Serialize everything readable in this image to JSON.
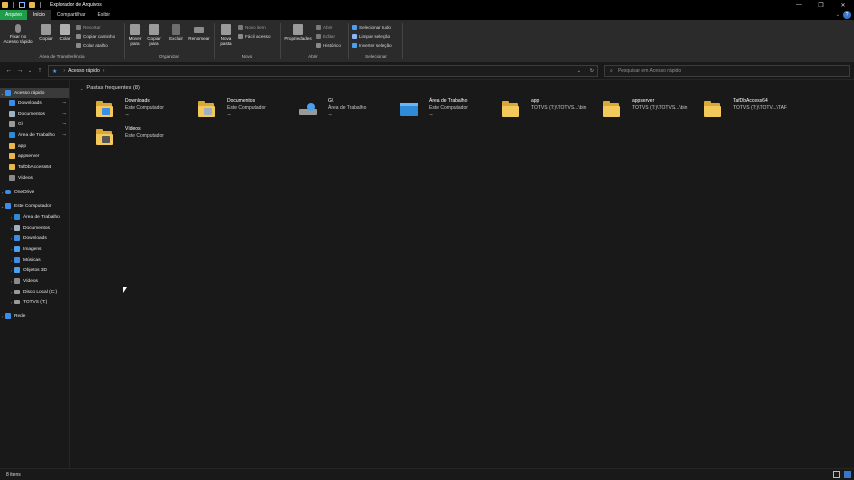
{
  "window": {
    "title": "Explorador de Arquivos",
    "controls": {
      "minimize": "—",
      "maximize": "❐",
      "close": "✕"
    },
    "help": "?",
    "collapse": "⌄"
  },
  "ribbon_tabs": [
    {
      "label": "Arquivo"
    },
    {
      "label": "Início"
    },
    {
      "label": "Compartilhar"
    },
    {
      "label": "Exibir"
    }
  ],
  "ribbon": {
    "clipboard": {
      "pin_quick": "Fixar no Acesso rápido",
      "copy": "Copiar",
      "paste": "Colar",
      "cut": "Recortar",
      "copy_path": "Copiar caminho",
      "paste_shortcut": "Colar atalho",
      "label": "Área de Transferência"
    },
    "organize": {
      "move_to": "Mover para",
      "copy_to": "Copiar para",
      "delete": "Excluir",
      "rename": "Renomear",
      "label": "Organizar"
    },
    "new": {
      "new_folder": "Nova pasta",
      "new_item": "Novo item",
      "easy_access": "Fácil acesso",
      "label": "Novo"
    },
    "open": {
      "properties": "Propriedades",
      "open": "Abrir",
      "edit": "Editar",
      "history": "Histórico",
      "label": "Abrir"
    },
    "select": {
      "select_all": "Selecionar tudo",
      "select_none": "Limpar seleção",
      "invert": "Inverter seleção",
      "label": "Selecionar"
    }
  },
  "navbar": {
    "back": "←",
    "forward": "→",
    "recent": "⌄",
    "up": "↑",
    "breadcrumb": "Acesso rápido",
    "search_placeholder": "Pesquisar em Acesso rápido"
  },
  "sidebar": {
    "items": [
      {
        "label": "Acesso rápido",
        "icon": "star-icon",
        "color": "#3a8ee6",
        "selected": true
      },
      {
        "label": "Downloads",
        "icon": "downloads-icon",
        "color": "#3a8ee6",
        "pinned": true
      },
      {
        "label": "Documentos",
        "icon": "documents-icon",
        "color": "#9fb0c3",
        "pinned": true
      },
      {
        "label": "G\\",
        "icon": "drive-icon",
        "color": "#9a9a9a",
        "pinned": true
      },
      {
        "label": "Área de Trabalho",
        "icon": "desktop-icon",
        "color": "#2f8bd8",
        "pinned": true
      },
      {
        "label": "app",
        "icon": "folder-icon",
        "color": "#e8b84a"
      },
      {
        "label": "appserver",
        "icon": "folder-icon",
        "color": "#e8b84a"
      },
      {
        "label": "TafDbAccess64",
        "icon": "folder-icon",
        "color": "#e8b84a"
      },
      {
        "label": "Vídeos",
        "icon": "videos-icon",
        "color": "#8a8a8a"
      },
      {
        "label": "OneDrive",
        "icon": "cloud-icon",
        "color": "#3a8ee6"
      },
      {
        "label": "Este Computador",
        "icon": "computer-icon",
        "color": "#3a8ee6"
      },
      {
        "label": "Área de Trabalho",
        "icon": "desktop-icon",
        "color": "#2f8bd8"
      },
      {
        "label": "Documentos",
        "icon": "documents-icon",
        "color": "#9fb0c3"
      },
      {
        "label": "Downloads",
        "icon": "downloads-icon",
        "color": "#3a8ee6"
      },
      {
        "label": "Imagens",
        "icon": "pictures-icon",
        "color": "#4aa0f0"
      },
      {
        "label": "Músicas",
        "icon": "music-icon",
        "color": "#3a8ee6"
      },
      {
        "label": "Objetos 3D",
        "icon": "objects-3d-icon",
        "color": "#4aa0f0"
      },
      {
        "label": "Vídeos",
        "icon": "videos-icon",
        "color": "#8a8a8a"
      },
      {
        "label": "Disco Local (C:)",
        "icon": "disk-icon",
        "color": "#9a9a9a"
      },
      {
        "label": "TOTVS (T:)",
        "icon": "network-drive-icon",
        "color": "#9a9a9a"
      },
      {
        "label": "Rede",
        "icon": "network-icon",
        "color": "#3a8ee6"
      }
    ],
    "pin_glyph": "📌"
  },
  "content": {
    "section_title": "Pastas frequentes (8)",
    "tiles": [
      {
        "name": "Downloads",
        "sub": "Este Computador",
        "pinned": true,
        "icon": "downloads-folder-icon",
        "badge": "#3a8ee6"
      },
      {
        "name": "Documentos",
        "sub": "Este Computador",
        "pinned": true,
        "icon": "documents-folder-icon",
        "badge": "#9fb0c3"
      },
      {
        "name": "G\\",
        "sub": "Área de Trabalho",
        "pinned": true,
        "icon": "drive-icon",
        "badge": "#aaaaaa"
      },
      {
        "name": "Área de Trabalho",
        "sub": "Este Computador",
        "pinned": true,
        "icon": "desktop-folder-icon",
        "badge": "#2f8bd8"
      },
      {
        "name": "app",
        "sub": "TOTVS (T:)\\TOTVS...\\bin",
        "pinned": false,
        "icon": "folder-icon",
        "badge": ""
      },
      {
        "name": "appserver",
        "sub": "TOTVS (T:)\\TOTVS...\\bin",
        "pinned": false,
        "icon": "folder-icon",
        "badge": ""
      },
      {
        "name": "TafDbAccess64",
        "sub": "TOTVS (T:)\\TOTV...\\TAF",
        "pinned": false,
        "icon": "folder-icon",
        "badge": ""
      },
      {
        "name": "Vídeos",
        "sub": "Este Computador",
        "pinned": false,
        "icon": "videos-folder-icon",
        "badge": "#555555"
      }
    ]
  },
  "status": {
    "items": "8 itens"
  }
}
